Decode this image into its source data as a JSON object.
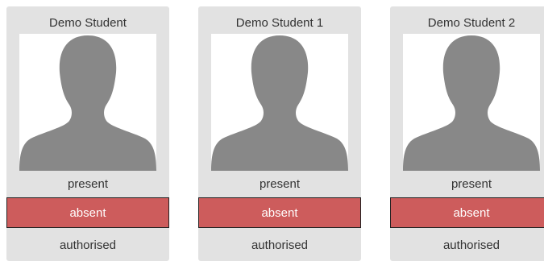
{
  "students": [
    {
      "name": "Demo Student",
      "photo_icon": "person-silhouette-icon",
      "statuses": {
        "present": "present",
        "absent": "absent",
        "authorised": "authorised"
      },
      "selected": "absent"
    },
    {
      "name": "Demo Student 1",
      "photo_icon": "person-silhouette-icon",
      "statuses": {
        "present": "present",
        "absent": "absent",
        "authorised": "authorised"
      },
      "selected": "absent"
    },
    {
      "name": "Demo Student 2",
      "photo_icon": "person-silhouette-icon",
      "statuses": {
        "present": "present",
        "absent": "absent",
        "authorised": "authorised"
      },
      "selected": "absent"
    }
  ],
  "colors": {
    "card_bg": "#e2e2e2",
    "selected_bg": "#cd5c5c",
    "silhouette": "#888888"
  }
}
